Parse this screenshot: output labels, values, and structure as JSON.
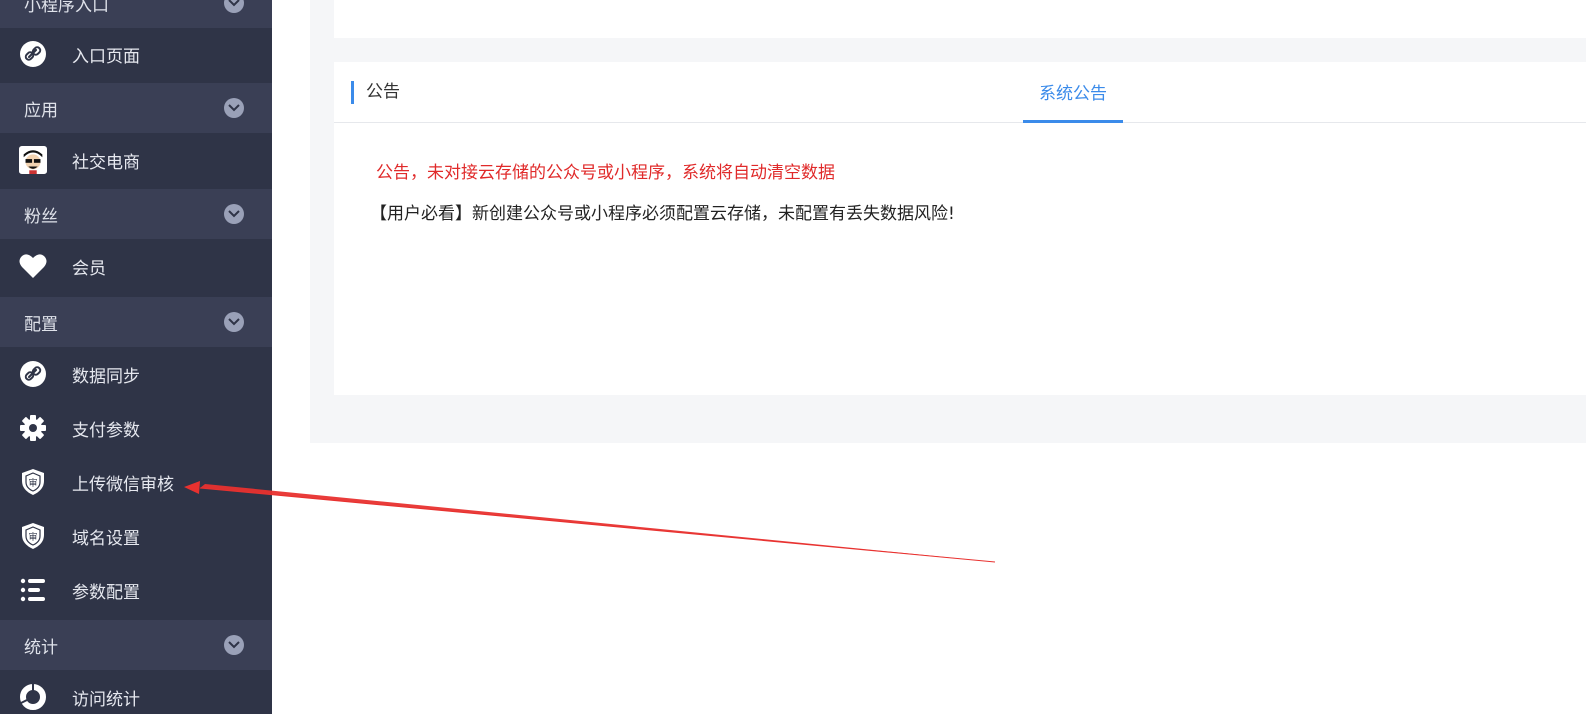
{
  "sidebar": {
    "sections": [
      {
        "label": "小程序入口"
      },
      {
        "label": "应用"
      },
      {
        "label": "粉丝"
      },
      {
        "label": "配置"
      },
      {
        "label": "统计"
      }
    ],
    "items": {
      "entry_page": {
        "label": "入口页面",
        "icon": "link-icon"
      },
      "social_ecommerce": {
        "label": "社交电商",
        "icon": "mascot-avatar-icon"
      },
      "member": {
        "label": "会员",
        "icon": "heart-icon"
      },
      "data_sync": {
        "label": "数据同步",
        "icon": "link-icon"
      },
      "payment_params": {
        "label": "支付参数",
        "icon": "gear-icon"
      },
      "upload_wechat_review": {
        "label": "上传微信审核",
        "icon": "shield-review-icon"
      },
      "domain_settings": {
        "label": "域名设置",
        "icon": "shield-review-icon"
      },
      "param_config": {
        "label": "参数配置",
        "icon": "list-icon"
      },
      "visit_stats": {
        "label": "访问统计",
        "icon": "donut-chart-icon"
      }
    },
    "shield_char": "审"
  },
  "notice": {
    "title": "公告",
    "tab_label": "系统公告",
    "red_text": "公告，未对接云存储的公众号或小程序，系统将自动清空数据",
    "black_text": "【用户必看】新创建公众号或小程序必须配置云存储，未配置有丢失数据风险!"
  },
  "colors": {
    "sidebar_bg": "#2f3447",
    "section_bg": "#3a3f55",
    "accent": "#3b8bea",
    "warning_red": "#e02a2a",
    "annotation_arrow": "#e8312f"
  }
}
